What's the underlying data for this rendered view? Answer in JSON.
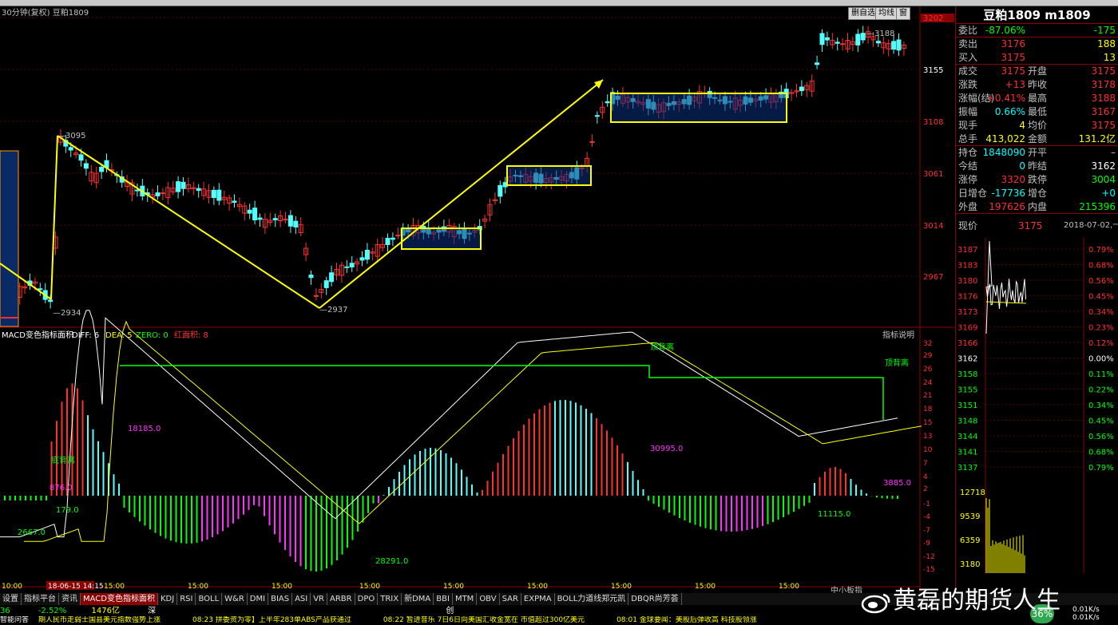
{
  "window": {
    "title_left": "30分钟(复权) 豆粕1809",
    "buttons": [
      "删自选",
      "均线",
      "窗"
    ]
  },
  "price_axis": [
    "3202",
    "3155",
    "3108",
    "3061",
    "3014",
    "2967"
  ],
  "annotations": {
    "high": "3095",
    "low1": "2934",
    "low2": "2937",
    "peak": "3188"
  },
  "indicator": {
    "name": "MACD变色指标面积",
    "diff": "DIFF: 6",
    "dea": "DEA: 5",
    "zero": "ZERO: 0",
    "area": "红面积: 8",
    "help": "指标说明",
    "labels": [
      "顶背离",
      "顶背离",
      "底背离",
      "18185.0",
      "876.0",
      "179.0",
      "2667.0",
      "30995.0",
      "28291.0",
      "3885.0",
      "11115.0"
    ],
    "axis": [
      "32",
      "29",
      "26",
      "24",
      "21",
      "18",
      "15",
      "13",
      "10",
      "7",
      "4",
      "2",
      "-1",
      "-4",
      "-7",
      "-9",
      "-12",
      "-15"
    ]
  },
  "time_axis": [
    "10:00",
    "18-06-15 14:15",
    "15:00",
    "15:00",
    "15:00",
    "15:00",
    "15:00",
    "15:00",
    "15:00",
    "15:00",
    "15:00",
    "15:00"
  ],
  "small_board": "中小板指",
  "quote": {
    "title": "豆粕1809 m1809",
    "rows": [
      {
        "l": "委比",
        "v": "-87.06%",
        "v2": "-175",
        "c": "#00ff00",
        "c2": "#00ff00"
      },
      {
        "l": "卖出",
        "v": "3176",
        "v2": "188",
        "c": "#ff3030",
        "c2": "#ffff00"
      },
      {
        "l": "买入",
        "v": "3175",
        "v2": "13",
        "c": "#ff3030",
        "c2": "#ffff00"
      }
    ],
    "rows2": [
      [
        "成交",
        "3175",
        "开盘",
        "3175",
        "#ff3030",
        "#ff3030"
      ],
      [
        "涨跌",
        "+13",
        "昨收",
        "3178",
        "#ff3030",
        "#ff3030"
      ],
      [
        "涨幅(结)",
        "+0.41%",
        "最高",
        "3188",
        "#ff3030",
        "#ff3030"
      ],
      [
        "振幅",
        "0.66%",
        "最低",
        "3167",
        "#00ffff",
        "#ff3030"
      ],
      [
        "现手",
        "4",
        "均价",
        "3175",
        "#ffff00",
        "#ff3030"
      ],
      [
        "总手",
        "413,022",
        "金额",
        "131.2亿",
        "#ffff00",
        "#ffff00"
      ]
    ],
    "rows3": [
      [
        "持仓",
        "1848090",
        "开平",
        "–",
        "#00ffff",
        "#c0c0c0"
      ],
      [
        "今结",
        "0",
        "昨结",
        "3162",
        "#00ffff",
        "#fff"
      ],
      [
        "涨停",
        "3320",
        "跌停",
        "3004",
        "#ff3030",
        "#00ff00"
      ],
      [
        "日增仓",
        "-17736",
        "增仓",
        "+0",
        "#00ffff",
        "#00ffff"
      ],
      [
        "外盘",
        "197626",
        "内盘",
        "215396",
        "#ff3030",
        "#00ff00"
      ]
    ],
    "price_now_label": "现价",
    "price_now": "3175",
    "date": "2018-07-02,一",
    "mini_axis_left": [
      "3187",
      "3183",
      "3180",
      "3176",
      "3173",
      "3169",
      "3166",
      "3162",
      "3158",
      "3155",
      "3151",
      "3148",
      "3144",
      "3141",
      "3137"
    ],
    "mini_axis_right": [
      "0.79%",
      "0.68%",
      "0.56%",
      "0.45%",
      "0.34%",
      "0.23%",
      "0.12%",
      "0.00%",
      "0.11%",
      "0.22%",
      "0.34%",
      "0.45%",
      "0.56%",
      "0.68%",
      "0.79%"
    ],
    "vol_axis": [
      "12718",
      "9539",
      "6359",
      "3180"
    ]
  },
  "tabs": [
    "设置",
    "指标平台",
    "资讯",
    "MACD变色指标面积",
    "KDJ",
    "RSI",
    "BOLL",
    "W&R",
    "DMI",
    "BIAS",
    "ASI",
    "VR",
    "ARBR",
    "DPO",
    "TRIX",
    "新DMA",
    "BBI",
    "MTM",
    "OBV",
    "SAR",
    "EXPMA",
    "BOLL力道线郑元凯",
    "DBQR尚芳荟"
  ],
  "status": {
    "a": "36",
    "b": "-2.52%",
    "c": "1476亿",
    "d": "深",
    "e": "创"
  },
  "ticker": [
    "智能问答",
    "期人民币走弱士国县美元指数强势上涨",
    "08:23 拼委资为零】上半年283单ABS产品获通过",
    "08:22 暂进音乐 7日6日向美国汇收金宽在 市值超过300亿美元",
    "08:01 金球要闻：美股后弹收高 科技股领涨"
  ],
  "badge": "36%",
  "speeds": [
    "0.01K/s",
    "0.01K/s"
  ],
  "watermark": "黄磊的期货人生"
}
